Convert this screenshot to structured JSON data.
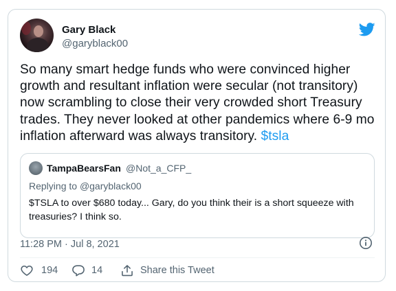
{
  "author": {
    "name": "Gary Black",
    "handle": "@garyblack00"
  },
  "tweet": {
    "text_main": "So many smart hedge funds who were convinced higher growth and resultant inflation were secular (not transitory) now scrambling to close their very crowded short Treasury trades. They never looked at other pandemics where 6-9 mo inflation afterward was always transitory. ",
    "cashtag": "$tsla"
  },
  "quoted": {
    "name": "TampaBearsFan",
    "handle": "@Not_a_CFP_",
    "replying_prefix": "Replying to ",
    "replying_to": "@garyblack00",
    "text": "$TSLA to over $680 today... Gary, do you think their is a short squeeze with treasuries?  I think so."
  },
  "meta": {
    "timestamp": "11:28 PM · Jul 8, 2021"
  },
  "actions": {
    "likes": "194",
    "replies": "14",
    "share_label": "Share this Tweet"
  },
  "icons": {
    "brand": "twitter-bird-icon",
    "info": "info-icon",
    "like": "heart-icon",
    "reply": "reply-bubble-icon",
    "share": "share-arrow-icon"
  },
  "colors": {
    "accent": "#1d9bf0",
    "secondary_text": "#536471",
    "border": "#cfd9de"
  }
}
